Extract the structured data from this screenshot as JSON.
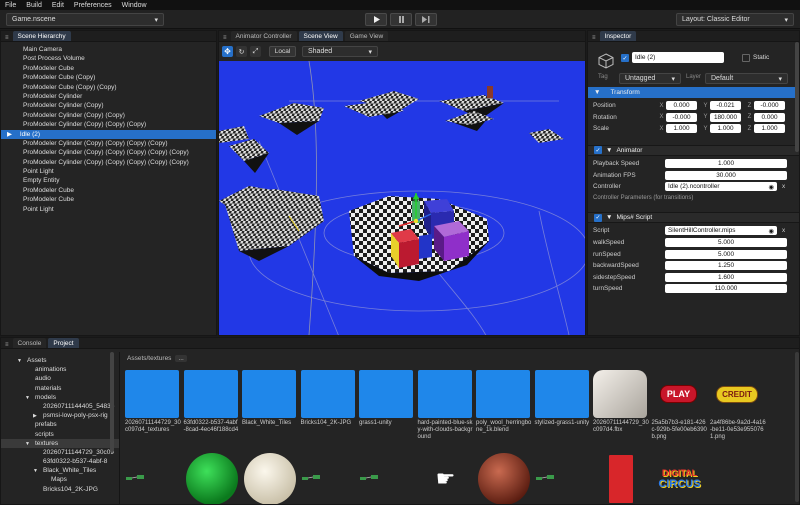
{
  "menu": [
    "File",
    "Build",
    "Edit",
    "Preferences",
    "Window"
  ],
  "toolbar": {
    "scene_file": "Game.nscene",
    "play_icon": "play-icon",
    "pause_icon": "pause-icon",
    "step_icon": "step-icon",
    "layout": "Layout: Classic Editor"
  },
  "hierarchy": {
    "tab": "Scene Hierarchy",
    "items": [
      "Main Camera",
      "Post Process Volume",
      "ProModeler Cube",
      "ProModeler Cube (Copy)",
      "ProModeler Cube (Copy) (Copy)",
      "ProModeler Cylinder",
      "ProModeler Cylinder (Copy)",
      "ProModeler Cylinder (Copy) (Copy)",
      "ProModeler Cylinder (Copy) (Copy) (Copy)",
      "Idle (2)",
      "ProModeler Cylinder (Copy) (Copy) (Copy) (Copy)",
      "ProModeler Cylinder (Copy) (Copy) (Copy) (Copy) (Copy)",
      "ProModeler Cylinder (Copy) (Copy) (Copy) (Copy) (Copy)",
      "Point Light",
      "Empty Entity",
      "ProModeler Cube",
      "ProModeler Cube",
      "Point Light"
    ],
    "selected_index": 9
  },
  "viewport": {
    "tabs": [
      "Animator Controller",
      "Scene View",
      "Game View"
    ],
    "active_tab": 1,
    "space_button": "Local",
    "render_mode": "Shaded",
    "background_color": "#2238e6"
  },
  "inspector": {
    "tab": "Inspector",
    "object_name": "Idle (2)",
    "static_label": "Static",
    "tag_label": "Tag",
    "tag_value": "Untagged",
    "layer_label": "Layer",
    "layer_value": "Default",
    "transform": {
      "title": "Transform",
      "position_label": "Position",
      "rotation_label": "Rotation",
      "scale_label": "Scale",
      "position": [
        "0.000",
        "-0.021",
        "-0.000"
      ],
      "rotation": [
        "-0.000",
        "180.000",
        "0.000"
      ],
      "scale": [
        "1.000",
        "1.000",
        "1.000"
      ]
    },
    "animator": {
      "title": "Animator",
      "playback_label": "Playback Speed",
      "playback_value": "1.000",
      "fps_label": "Animation FPS",
      "fps_value": "30.000",
      "controller_label": "Controller",
      "controller_value": "Idle (2).ncontroller",
      "params_label": "Controller Parameters (for transitions)"
    },
    "script": {
      "title": "Mips# Script",
      "script_label": "Script",
      "script_value": "SilentHillController.mips",
      "fields": [
        {
          "label": "walkSpeed",
          "value": "5.000"
        },
        {
          "label": "runSpeed",
          "value": "5.000"
        },
        {
          "label": "backwardSpeed",
          "value": "1.250"
        },
        {
          "label": "sidestepSpeed",
          "value": "1.600"
        },
        {
          "label": "turnSpeed",
          "value": "110.000"
        }
      ]
    },
    "axis": [
      "X",
      "Y",
      "Z"
    ],
    "clear": "x",
    "accent": "#2670c9"
  },
  "bottom": {
    "tabs": [
      "Console",
      "Project"
    ],
    "active_tab": 1,
    "breadcrumb": "Assets/textures",
    "breadcrumb_more": "...",
    "tree": [
      {
        "label": "Assets",
        "indent": 0,
        "arrow": "▼"
      },
      {
        "label": "animations",
        "indent": 1,
        "arrow": ""
      },
      {
        "label": "audio",
        "indent": 1,
        "arrow": ""
      },
      {
        "label": "materials",
        "indent": 1,
        "arrow": ""
      },
      {
        "label": "models",
        "indent": 1,
        "arrow": "▼"
      },
      {
        "label": "20260711144405_5483b",
        "indent": 2,
        "arrow": ""
      },
      {
        "label": "psmsi-low-poly-psx-rig",
        "indent": 2,
        "arrow": "▶"
      },
      {
        "label": "prefabs",
        "indent": 1,
        "arrow": ""
      },
      {
        "label": "scripts",
        "indent": 1,
        "arrow": ""
      },
      {
        "label": "textures",
        "indent": 1,
        "arrow": "▼"
      },
      {
        "label": "20260711144729_30c09",
        "indent": 2,
        "arrow": ""
      },
      {
        "label": "63fd0322-b537-4abf-8",
        "indent": 2,
        "arrow": ""
      },
      {
        "label": "Black_White_Tiles",
        "indent": 2,
        "arrow": "▼"
      },
      {
        "label": "Maps",
        "indent": 3,
        "arrow": ""
      },
      {
        "label": "Bricks104_2K-JPG",
        "indent": 2,
        "arrow": ""
      }
    ],
    "tree_selected": 9,
    "assets_row1": [
      "20260711144729_30c097d4_textures",
      "63fd0322-b537-4abf-8cad-4ec46f188cd4",
      "Black_White_Tiles",
      "Bricks104_2K-JPG",
      "grass1-unity",
      "hard-painted-blue-sky-with-clouds-background",
      "poly_wool_herringbone_1k.blend",
      "stylized-grass1-unity",
      "20260711144729_30c097d4.fbx",
      "25a5b7b3-e181-426c-929b-5fe00eb6390b.png",
      "2a4f86be-9a2d-4a16-be11-0e53e9550761.png"
    ],
    "play_text": "PLAY",
    "credit_text": "CREDIT",
    "digital_circus_lines": [
      "DIGITAL",
      "CIRCUS"
    ]
  }
}
